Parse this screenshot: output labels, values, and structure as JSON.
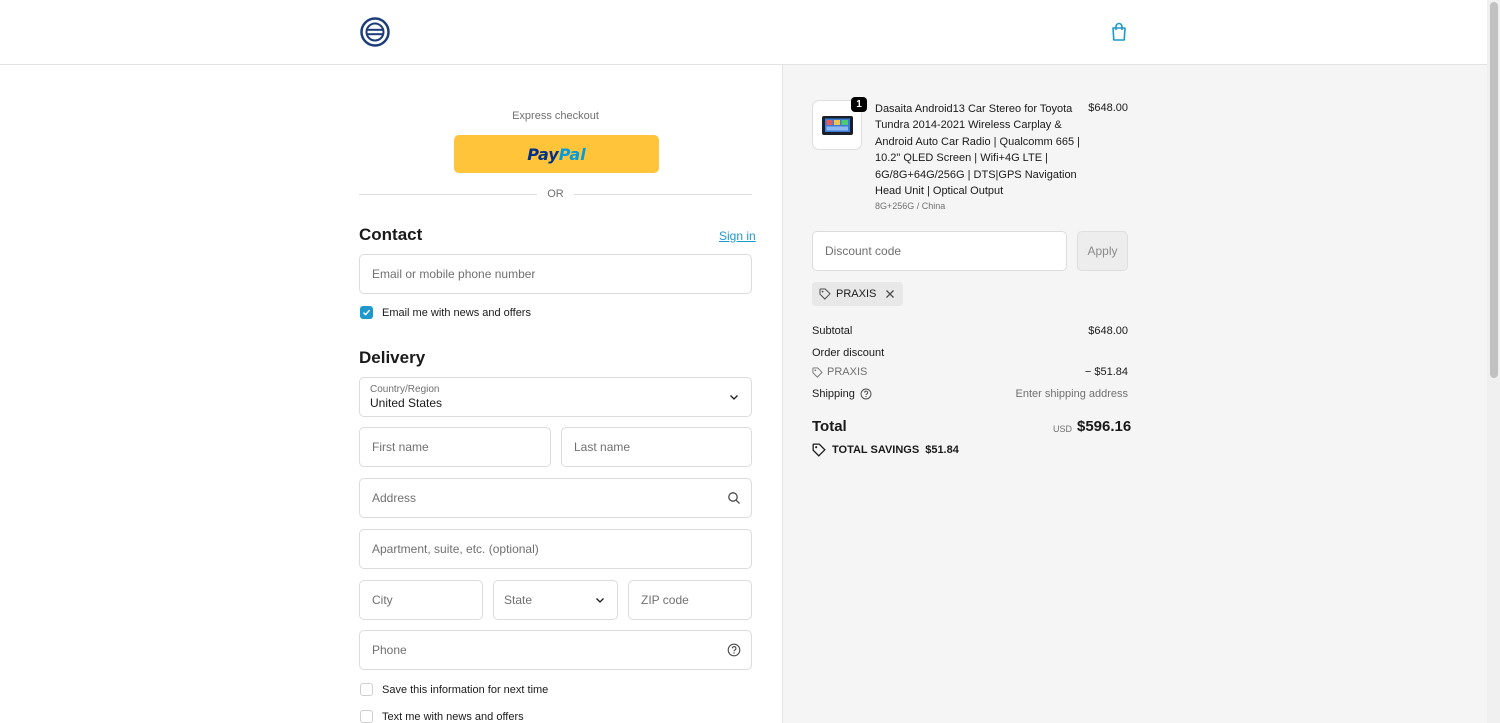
{
  "express": {
    "label": "Express checkout",
    "paypal_part1": "Pay",
    "paypal_part2": "Pal"
  },
  "divider": {
    "or_text": "OR"
  },
  "contact": {
    "title": "Contact",
    "sign_in": "Sign in",
    "email_placeholder": "Email or mobile phone number",
    "newsletter_label": "Email me with news and offers",
    "newsletter_checked": true
  },
  "delivery": {
    "title": "Delivery",
    "country_label": "Country/Region",
    "country_value": "United States",
    "first_name_placeholder": "First name",
    "last_name_placeholder": "Last name",
    "address_placeholder": "Address",
    "apartment_placeholder": "Apartment, suite, etc. (optional)",
    "city_placeholder": "City",
    "state_placeholder": "State",
    "zip_placeholder": "ZIP code",
    "phone_placeholder": "Phone",
    "save_info_label": "Save this information for next time",
    "text_offers_label": "Text me with news and offers"
  },
  "summary": {
    "product": {
      "quantity": "1",
      "title": "Dasaita Android13 Car Stereo for Toyota Tundra 2014-2021 Wireless Carplay & Android Auto Car Radio | Qualcomm 665 | 10.2\" QLED Screen | Wifi+4G LTE | 6G/8G+64G/256G | DTS|GPS Navigation Head Unit | Optical Output",
      "variant": "8G+256G / China",
      "price": "$648.00"
    },
    "discount_placeholder": "Discount code",
    "apply_label": "Apply",
    "applied_code": "PRAXIS",
    "subtotal_label": "Subtotal",
    "subtotal_value": "$648.00",
    "order_discount_label": "Order discount",
    "discount_code_label": "PRAXIS",
    "discount_value": "− $51.84",
    "shipping_label": "Shipping",
    "shipping_value": "Enter shipping address",
    "total_label": "Total",
    "currency": "USD",
    "total_value": "$596.16",
    "savings_label": "TOTAL SAVINGS",
    "savings_value": "$51.84"
  },
  "colors": {
    "accent": "#1f99cc",
    "paypal_yellow": "#ffc439",
    "logo_navy": "#1c3d7a"
  },
  "icons": [
    "store-logo-icon",
    "shopping-bag-icon",
    "search-icon",
    "help-circle-icon",
    "chevron-down-icon",
    "tag-icon",
    "close-icon",
    "check-icon"
  ]
}
